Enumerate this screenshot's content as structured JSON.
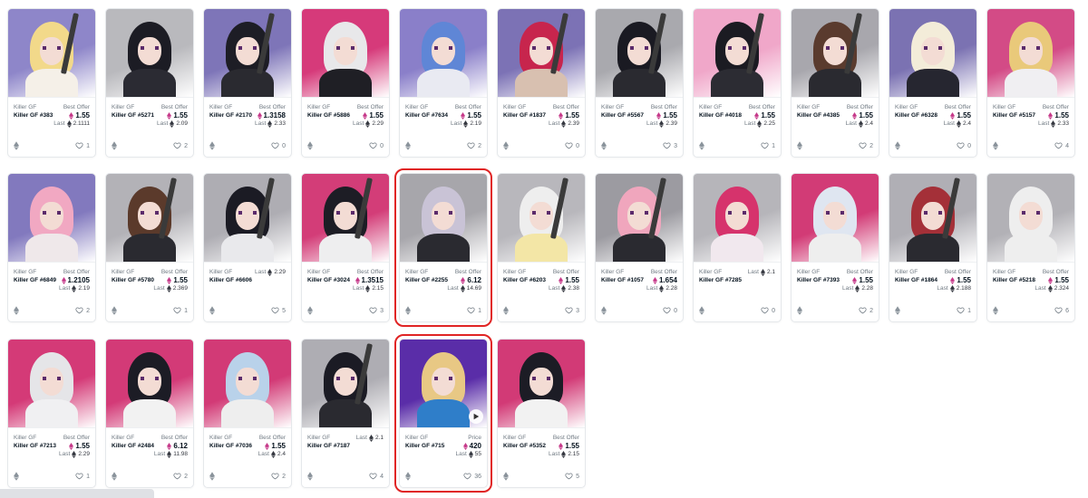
{
  "status_bar": {
    "url": ""
  },
  "rows": [
    [
      {
        "collection": "Killer GF",
        "name": "Killer GF #383",
        "price_label": "Best Offer",
        "price": "1.55",
        "last": "2.1111",
        "favorites": "1",
        "bg": "#8e86c9",
        "hair": "#f2d98a",
        "body": "#f5f0e8",
        "weapon": true
      },
      {
        "collection": "Killer GF",
        "name": "Killer GF #5271",
        "price_label": "Best Offer",
        "price": "1.55",
        "last": "2.09",
        "favorites": "2",
        "bg": "#b9b9bd",
        "hair": "#1c1c24",
        "body": "#2b2b33",
        "weapon": false
      },
      {
        "collection": "Killer GF",
        "name": "Killer GF #2170",
        "price_label": "Best Offer",
        "price": "1.3158",
        "last": "2.33",
        "favorites": "0",
        "bg": "#7e75b8",
        "hair": "#1d1d25",
        "body": "#2a2a30",
        "weapon": true
      },
      {
        "collection": "Killer GF",
        "name": "Killer GF #5886",
        "price_label": "Best Offer",
        "price": "1.55",
        "last": "2.29",
        "favorites": "0",
        "bg": "#d63a7a",
        "hair": "#e8e8ea",
        "body": "#1f1f25",
        "weapon": false
      },
      {
        "collection": "Killer GF",
        "name": "Killer GF #7634",
        "price_label": "Best Offer",
        "price": "1.55",
        "last": "2.19",
        "favorites": "2",
        "bg": "#8a7fc9",
        "hair": "#5f86d6",
        "body": "#e9eaf2",
        "weapon": false
      },
      {
        "collection": "Killer GF",
        "name": "Killer GF #1837",
        "price_label": "Best Offer",
        "price": "1.55",
        "last": "2.39",
        "favorites": "0",
        "bg": "#7c72b5",
        "hair": "#c7254d",
        "body": "#d8c0b0",
        "weapon": true
      },
      {
        "collection": "Killer GF",
        "name": "Killer GF #5567",
        "price_label": "Best Offer",
        "price": "1.55",
        "last": "2.39",
        "favorites": "3",
        "bg": "#a9a9ae",
        "hair": "#1a1a22",
        "body": "#2a2a30",
        "weapon": true
      },
      {
        "collection": "Killer GF",
        "name": "Killer GF #4018",
        "price_label": "Best Offer",
        "price": "1.55",
        "last": "2.25",
        "favorites": "1",
        "bg": "#f0a7c9",
        "hair": "#1b1b22",
        "body": "#2c2c33",
        "weapon": true
      },
      {
        "collection": "Killer GF",
        "name": "Killer GF #4385",
        "price_label": "Best Offer",
        "price": "1.55",
        "last": "2.4",
        "favorites": "2",
        "bg": "#a8a7ad",
        "hair": "#5a3b2e",
        "body": "#2a2a30",
        "weapon": true
      },
      {
        "collection": "Killer GF",
        "name": "Killer GF #6328",
        "price_label": "Best Offer",
        "price": "1.55",
        "last": "2.4",
        "favorites": "0",
        "bg": "#7b72b2",
        "hair": "#f3ecd9",
        "body": "#262630",
        "weapon": false
      },
      {
        "collection": "Killer GF",
        "name": "Killer GF #5157",
        "price_label": "Best Offer",
        "price": "1.55",
        "last": "2.33",
        "favorites": "4",
        "bg": "#d34b86",
        "hair": "#e9c97a",
        "body": "#f0eff2",
        "weapon": false
      }
    ],
    [
      {
        "collection": "Killer GF",
        "name": "Killer GF #6849",
        "price_label": "Best Offer",
        "price": "1.2105",
        "last": "2.19",
        "favorites": "2",
        "bg": "#8279be",
        "hair": "#f1a8c2",
        "body": "#efe8ea",
        "weapon": false
      },
      {
        "collection": "Killer GF",
        "name": "Killer GF #5780",
        "price_label": "Best Offer",
        "price": "1.55",
        "last": "2.369",
        "favorites": "1",
        "bg": "#b3b2b7",
        "hair": "#5b3a2b",
        "body": "#2a2a30",
        "weapon": true
      },
      {
        "collection": "Killer GF",
        "name": "Killer GF #6606",
        "price_label": "",
        "price": "",
        "last": "2.29",
        "favorites": "5",
        "bg": "#aeadb3",
        "hair": "#1b1b24",
        "body": "#e9e9ec",
        "weapon": true
      },
      {
        "collection": "Killer GF",
        "name": "Killer GF #3024",
        "price_label": "Best Offer",
        "price": "1.3515",
        "last": "2.15",
        "favorites": "3",
        "bg": "#d33d78",
        "hair": "#1d1d25",
        "body": "#eeeeef",
        "weapon": true
      },
      {
        "collection": "Killer GF",
        "name": "Killer GF #2255",
        "price_label": "Best Offer",
        "price": "6.12",
        "last": "14.69",
        "favorites": "1",
        "bg": "#a7a6ab",
        "hair": "#c9c3d6",
        "body": "#2a2a30",
        "weapon": false,
        "highlight": true
      },
      {
        "collection": "Killer GF",
        "name": "Killer GF #6203",
        "price_label": "Best Offer",
        "price": "1.55",
        "last": "2.38",
        "favorites": "3",
        "bg": "#b8b7bc",
        "hair": "#eeeeee",
        "body": "#f3e6a6",
        "weapon": true
      },
      {
        "collection": "Killer GF",
        "name": "Killer GF #1057",
        "price_label": "Best Offer",
        "price": "1.654",
        "last": "2.28",
        "favorites": "0",
        "bg": "#9c9ba1",
        "hair": "#f0a6bd",
        "body": "#2a2a30",
        "weapon": true
      },
      {
        "collection": "Killer GF",
        "name": "Killer GF #7285",
        "price_label": "",
        "price": "",
        "last": "2.1",
        "favorites": "0",
        "bg": "#b6b5ba",
        "hair": "#d6336c",
        "body": "#f1e8ee",
        "weapon": false
      },
      {
        "collection": "Killer GF",
        "name": "Killer GF #7393",
        "price_label": "Best Offer",
        "price": "1.55",
        "last": "2.28",
        "favorites": "2",
        "bg": "#d23b76",
        "hair": "#dfe6f1",
        "body": "#eeeeee",
        "weapon": false
      },
      {
        "collection": "Killer GF",
        "name": "Killer GF #1864",
        "price_label": "Best Offer",
        "price": "1.55",
        "last": "2.188",
        "favorites": "1",
        "bg": "#b0afb5",
        "hair": "#a43038",
        "body": "#2a2a30",
        "weapon": true
      },
      {
        "collection": "Killer GF",
        "name": "Killer GF #5218",
        "price_label": "Best Offer",
        "price": "1.55",
        "last": "2.324",
        "favorites": "6",
        "bg": "#b2b1b6",
        "hair": "#eeeeee",
        "body": "#eeeeee",
        "weapon": false
      }
    ],
    [
      {
        "collection": "Killer GF",
        "name": "Killer GF #7213",
        "price_label": "Best Offer",
        "price": "1.55",
        "last": "2.29",
        "favorites": "1",
        "bg": "#d43a77",
        "hair": "#e5e5e8",
        "body": "#f0f0f2",
        "weapon": false
      },
      {
        "collection": "Killer GF",
        "name": "Killer GF #2484",
        "price_label": "Best Offer",
        "price": "6.12",
        "last": "11.98",
        "favorites": "2",
        "bg": "#d33a77",
        "hair": "#1c1c25",
        "body": "#f2f2f2",
        "weapon": false
      },
      {
        "collection": "Killer GF",
        "name": "Killer GF #7036",
        "price_label": "Best Offer",
        "price": "1.55",
        "last": "2.4",
        "favorites": "2",
        "bg": "#d23a76",
        "hair": "#b9d2ea",
        "body": "#eeeeee",
        "weapon": false
      },
      {
        "collection": "Killer GF",
        "name": "Killer GF #7187",
        "price_label": "",
        "price": "",
        "last": "2.1",
        "favorites": "4",
        "bg": "#aeadb3",
        "hair": "#1b1b24",
        "body": "#2a2a30",
        "weapon": true
      },
      {
        "collection": "Killer GF",
        "name": "Killer GF #715",
        "price_label": "Price",
        "price": "420",
        "last": "55",
        "favorites": "36",
        "bg": "#5a2da8",
        "hair": "#e8c884",
        "body": "#2f7ec9",
        "weapon": false,
        "highlight": true,
        "video": true
      },
      {
        "collection": "Killer GF",
        "name": "Killer GF #5352",
        "price_label": "Best Offer",
        "price": "1.55",
        "last": "2.15",
        "favorites": "5",
        "bg": "#d23a76",
        "hair": "#1c1c25",
        "body": "#f2f2f2",
        "weapon": false
      }
    ]
  ],
  "labels": {
    "last": "Last"
  },
  "icons": {
    "eth": "ethereum-icon",
    "heart": "heart-icon",
    "play": "play-icon"
  },
  "colors": {
    "highlight": "#e02424",
    "eth_purple": "#c63a8a"
  }
}
